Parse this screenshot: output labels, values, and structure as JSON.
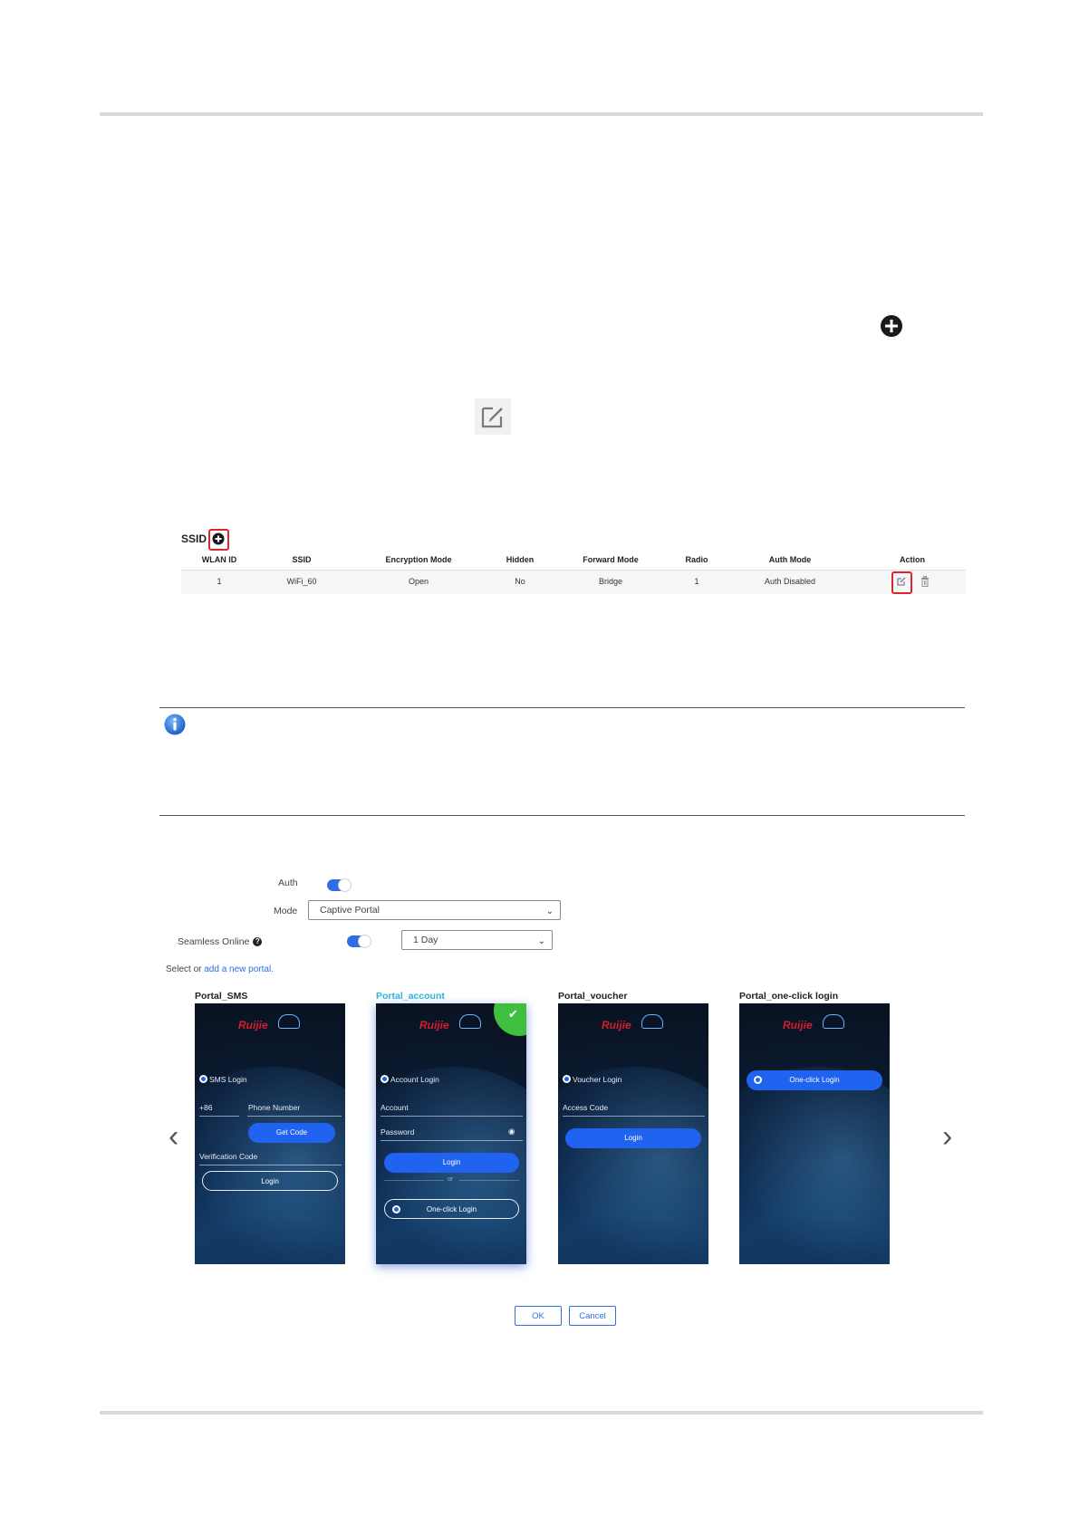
{
  "ssid_table": {
    "title": "SSID",
    "headers": [
      "WLAN ID",
      "SSID",
      "Encryption Mode",
      "Hidden",
      "Forward Mode",
      "Radio",
      "Auth Mode",
      "Action"
    ],
    "row": [
      "1",
      "WiFi_60",
      "Open",
      "No",
      "Bridge",
      "1",
      "Auth Disabled"
    ]
  },
  "auth_form": {
    "auth_label": "Auth",
    "mode_label": "Mode",
    "mode_value": "Captive Portal",
    "seamless_label": "Seamless Online",
    "seamless_value": "1 Day",
    "select_prefix": "Select or",
    "select_link": "add a new portal."
  },
  "portals": [
    {
      "name": "Portal_SMS",
      "heading": "SMS Login",
      "prefix": "+86",
      "field1": "Phone Number",
      "code_button": "Get Code",
      "field2": "Verification Code",
      "button": "Login"
    },
    {
      "name": "Portal_account",
      "heading": "Account Login",
      "field1": "Account",
      "field2": "Password",
      "button": "Login",
      "or": "or",
      "alt_button": "One-click Login"
    },
    {
      "name": "Portal_voucher",
      "heading": "Voucher Login",
      "field1": "Access Code",
      "button": "Login"
    },
    {
      "name": "Portal_one-click login",
      "button": "One-click Login"
    }
  ],
  "brand": "Ruijie",
  "buttons": {
    "ok": "OK",
    "cancel": "Cancel"
  },
  "colors": {
    "accent": "#2f6fe3",
    "highlight": "#e0242e",
    "selected": "#2fb5d6",
    "check": "#3fbf3f"
  }
}
